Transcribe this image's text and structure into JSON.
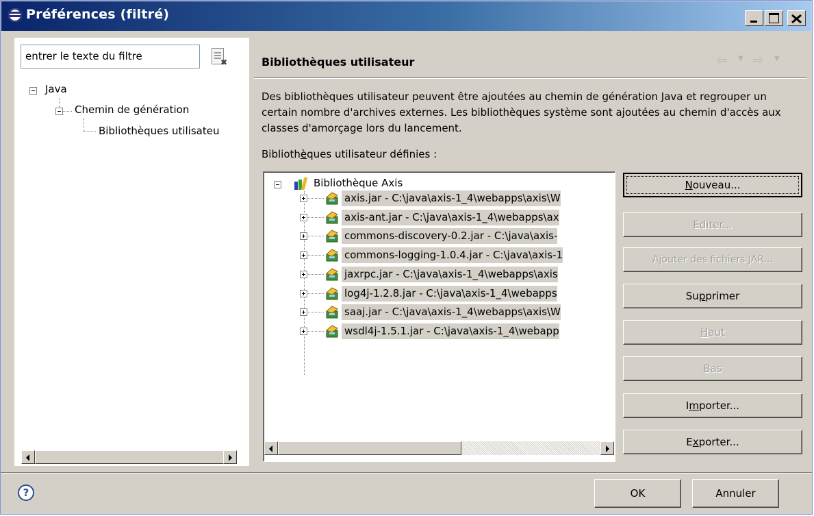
{
  "window": {
    "title": "Préférences (filtré)",
    "title_icon": "eclipse-icon",
    "controls": [
      "minimize",
      "maximize",
      "close"
    ]
  },
  "filter": {
    "value": "entrer le texte du filtre",
    "clear_icon": "clear-filter-icon"
  },
  "nav_tree": {
    "java": "Java",
    "build_path": "Chemin de génération",
    "user_libraries": "Bibliothèques utilisateu"
  },
  "page": {
    "title": "Bibliothèques utilisateur",
    "back_icon": "back-arrow-icon",
    "forward_icon": "forward-arrow-icon",
    "description": "Des bibliothèques utilisateur peuvent être ajoutées au chemin de génération Java et regrouper un certain nombre d'archives externes. Les bibliothèques système sont ajoutées au chemin d'accès aux classes d'amorçage lors du lancement.",
    "list_label_pre": "Biblioth",
    "list_label_mnemonic": "è",
    "list_label_post": "ques utilisateur définies :"
  },
  "library": {
    "name": "Bibliothèque Axis",
    "jars": [
      "axis.jar - C:\\java\\axis-1_4\\webapps\\axis\\W",
      "axis-ant.jar - C:\\java\\axis-1_4\\webapps\\ax",
      "commons-discovery-0.2.jar - C:\\java\\axis-",
      "commons-logging-1.0.4.jar - C:\\java\\axis-1",
      "jaxrpc.jar - C:\\java\\axis-1_4\\webapps\\axis",
      "log4j-1.2.8.jar - C:\\java\\axis-1_4\\webapps",
      "saaj.jar - C:\\java\\axis-1_4\\webapps\\axis\\W",
      "wsdl4j-1.5.1.jar - C:\\java\\axis-1_4\\webapp"
    ]
  },
  "buttons": {
    "new_pre": "",
    "new_m": "N",
    "new_post": "ouveau...",
    "edit_pre": "",
    "edit_m": "E",
    "edit_post": "diter...",
    "add_pre": "Ajouter des f",
    "add_m": "i",
    "add_post": "chiers JAR...",
    "remove_pre": "Su",
    "remove_m": "p",
    "remove_post": "primer",
    "up_pre": "",
    "up_m": "H",
    "up_post": "aut",
    "down_pre": "",
    "down_m": "B",
    "down_post": "as",
    "import_pre": "I",
    "import_m": "m",
    "import_post": "porter...",
    "export_pre": "E",
    "export_m": "x",
    "export_post": "porter...",
    "ok": "OK",
    "cancel": "Annuler",
    "help_icon": "help-icon"
  },
  "colors": {
    "title_gradient_start": "#0a246a",
    "title_gradient_end": "#a6caf0",
    "dialog_bg": "#d4d0c8",
    "disabled_text": "#a0a0a0"
  }
}
